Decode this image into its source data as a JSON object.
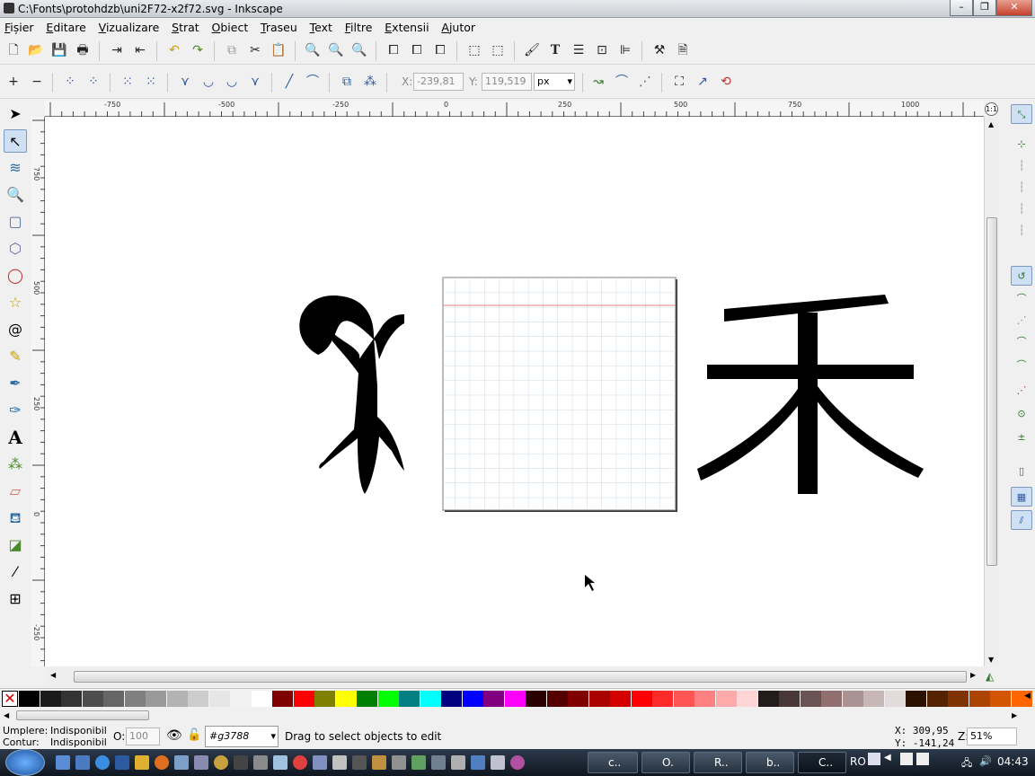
{
  "window": {
    "title": "C:\\Fonts\\protohdzb\\uni2F72-x2f72.svg - Inkscape"
  },
  "menu": [
    {
      "first": "F",
      "rest": "ișier"
    },
    {
      "first": "E",
      "rest": "ditare"
    },
    {
      "first": "V",
      "rest": "izualizare"
    },
    {
      "first": "S",
      "rest": "trat"
    },
    {
      "first": "O",
      "rest": "biect"
    },
    {
      "first": "T",
      "rest": "raseu"
    },
    {
      "first": "T",
      "rest": "ext"
    },
    {
      "first": "F",
      "rest": "iltre"
    },
    {
      "first": "E",
      "rest": "xtensii"
    },
    {
      "first": "A",
      "rest": "jutor"
    }
  ],
  "toolbar_nodes": {
    "x_label": "X:",
    "x_value": "-239,81",
    "y_label": "Y:",
    "y_value": "119,519",
    "unit": "px"
  },
  "ruler": {
    "h_ticks": [
      "-750",
      "-500",
      "-250",
      "0",
      "250",
      "500",
      "750",
      "1000"
    ],
    "v_ticks": [
      "750",
      "500",
      "250",
      "0",
      "-250"
    ]
  },
  "canvas": {
    "glyph_right": "禾"
  },
  "palette": {
    "colors": [
      "#000000",
      "#1a1a1a",
      "#333333",
      "#4d4d4d",
      "#666666",
      "#808080",
      "#999999",
      "#b3b3b3",
      "#cccccc",
      "#e6e6e6",
      "#f2f2f2",
      "#ffffff",
      "#800000",
      "#ff0000",
      "#808000",
      "#ffff00",
      "#008000",
      "#00ff00",
      "#008080",
      "#00ffff",
      "#000080",
      "#0000ff",
      "#800080",
      "#ff00ff",
      "#2b0000",
      "#550000",
      "#800000",
      "#aa0000",
      "#d40000",
      "#ff0000",
      "#ff2a2a",
      "#ff5555",
      "#ff8080",
      "#ffaaaa",
      "#ffd5d5",
      "#241c1c",
      "#483737",
      "#6c5353",
      "#916f6f",
      "#ac9393",
      "#c8b7b7",
      "#e3dbdb",
      "#2b1100",
      "#552200",
      "#803300",
      "#aa4400",
      "#d45500",
      "#ff6600"
    ]
  },
  "status": {
    "fill_label": "Umplere:",
    "fill_value": "Indisponibil",
    "stroke_label": "Contur:",
    "stroke_value": "Indisponibil",
    "opacity_label": "O:",
    "opacity_value": "100",
    "layer_value": "#g3788",
    "message": "Drag to select objects to edit",
    "cursor_x": "X:  309,95",
    "cursor_y": "Y: -141,24",
    "zoom_label": "Z:",
    "zoom_value": "51%"
  },
  "taskbar": {
    "tasks": [
      "c..",
      "O.",
      "R..",
      "b..",
      "C.."
    ],
    "lang": "RO",
    "clock": "04:43"
  }
}
